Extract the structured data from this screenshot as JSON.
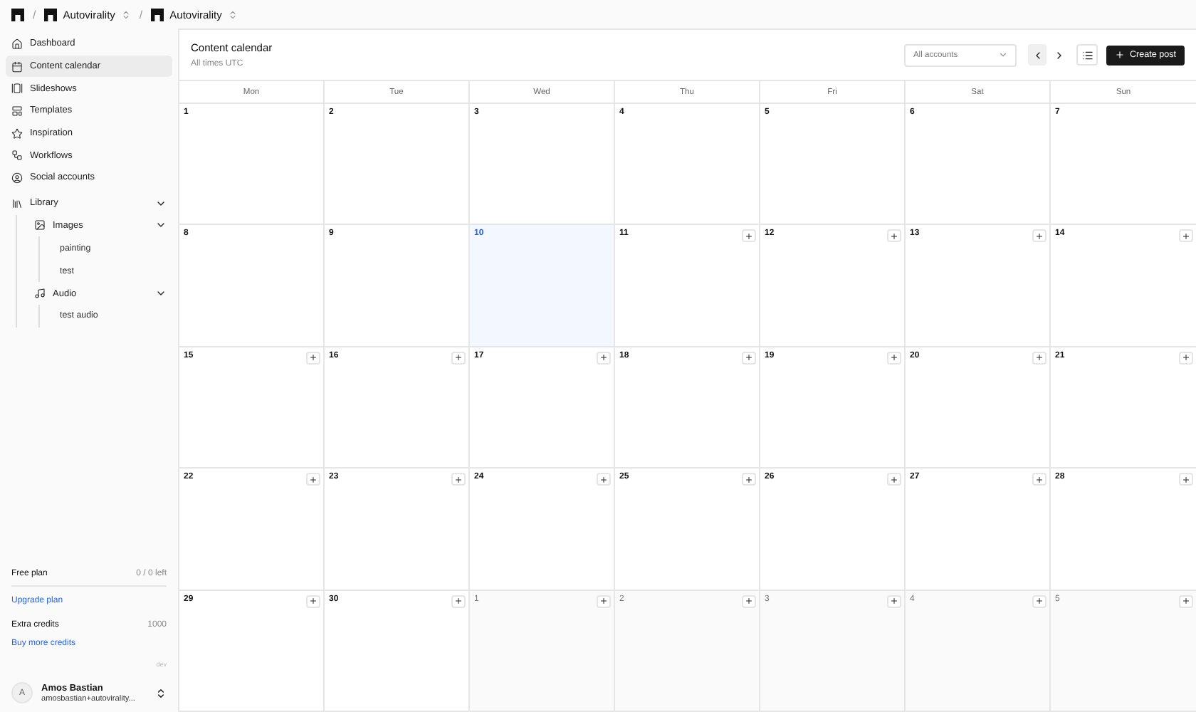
{
  "topbar": {
    "separators": [
      "/",
      "/"
    ],
    "workspace": "Autovirality",
    "project": "Autovirality"
  },
  "nav": [
    {
      "label": "Dashboard",
      "selected": false
    },
    {
      "label": "Content calendar",
      "selected": true
    },
    {
      "label": "Slideshows",
      "selected": false
    },
    {
      "label": "Templates",
      "selected": false
    },
    {
      "label": "Inspiration",
      "selected": false
    },
    {
      "label": "Workflows",
      "selected": false
    },
    {
      "label": "Social accounts",
      "selected": false
    }
  ],
  "library": {
    "label": "Library",
    "expanded": true,
    "children": [
      {
        "label": "Images",
        "expanded": true,
        "children": [
          {
            "label": "painting"
          },
          {
            "label": "test"
          }
        ]
      },
      {
        "label": "Audio",
        "expanded": true,
        "children": [
          {
            "label": "test audio"
          }
        ]
      }
    ]
  },
  "plan": {
    "name": "Free plan",
    "remaining": "0 / 0 left",
    "upgrade": "Upgrade plan",
    "credits_label": "Extra credits",
    "credits": "1000",
    "buy": "Buy more credits",
    "env": "dev"
  },
  "user": {
    "initial": "A",
    "name": "Amos Bastian",
    "email": "amosbastian+autovirality..."
  },
  "header": {
    "title": "Content calendar",
    "subtitle": "All times UTC",
    "filter": "All accounts",
    "create": "Create post"
  },
  "weekdays": [
    "Mon",
    "Tue",
    "Wed",
    "Thu",
    "Fri",
    "Sat",
    "Sun"
  ],
  "days": [
    {
      "day": "1",
      "today": false,
      "outside": false,
      "addable": false
    },
    {
      "day": "2",
      "today": false,
      "outside": false,
      "addable": false
    },
    {
      "day": "3",
      "today": false,
      "outside": false,
      "addable": false
    },
    {
      "day": "4",
      "today": false,
      "outside": false,
      "addable": false
    },
    {
      "day": "5",
      "today": false,
      "outside": false,
      "addable": false
    },
    {
      "day": "6",
      "today": false,
      "outside": false,
      "addable": false
    },
    {
      "day": "7",
      "today": false,
      "outside": false,
      "addable": false
    },
    {
      "day": "8",
      "today": false,
      "outside": false,
      "addable": false
    },
    {
      "day": "9",
      "today": false,
      "outside": false,
      "addable": false
    },
    {
      "day": "10",
      "today": true,
      "outside": false,
      "addable": false
    },
    {
      "day": "11",
      "today": false,
      "outside": false,
      "addable": true
    },
    {
      "day": "12",
      "today": false,
      "outside": false,
      "addable": true
    },
    {
      "day": "13",
      "today": false,
      "outside": false,
      "addable": true
    },
    {
      "day": "14",
      "today": false,
      "outside": false,
      "addable": true
    },
    {
      "day": "15",
      "today": false,
      "outside": false,
      "addable": true
    },
    {
      "day": "16",
      "today": false,
      "outside": false,
      "addable": true
    },
    {
      "day": "17",
      "today": false,
      "outside": false,
      "addable": true
    },
    {
      "day": "18",
      "today": false,
      "outside": false,
      "addable": true
    },
    {
      "day": "19",
      "today": false,
      "outside": false,
      "addable": true
    },
    {
      "day": "20",
      "today": false,
      "outside": false,
      "addable": true
    },
    {
      "day": "21",
      "today": false,
      "outside": false,
      "addable": true
    },
    {
      "day": "22",
      "today": false,
      "outside": false,
      "addable": true
    },
    {
      "day": "23",
      "today": false,
      "outside": false,
      "addable": true
    },
    {
      "day": "24",
      "today": false,
      "outside": false,
      "addable": true
    },
    {
      "day": "25",
      "today": false,
      "outside": false,
      "addable": true
    },
    {
      "day": "26",
      "today": false,
      "outside": false,
      "addable": true
    },
    {
      "day": "27",
      "today": false,
      "outside": false,
      "addable": true
    },
    {
      "day": "28",
      "today": false,
      "outside": false,
      "addable": true
    },
    {
      "day": "29",
      "today": false,
      "outside": false,
      "addable": true
    },
    {
      "day": "30",
      "today": false,
      "outside": false,
      "addable": true
    },
    {
      "day": "1",
      "today": false,
      "outside": true,
      "addable": true
    },
    {
      "day": "2",
      "today": false,
      "outside": true,
      "addable": true
    },
    {
      "day": "3",
      "today": false,
      "outside": true,
      "addable": true
    },
    {
      "day": "4",
      "today": false,
      "outside": true,
      "addable": true
    },
    {
      "day": "5",
      "today": false,
      "outside": true,
      "addable": true
    }
  ]
}
